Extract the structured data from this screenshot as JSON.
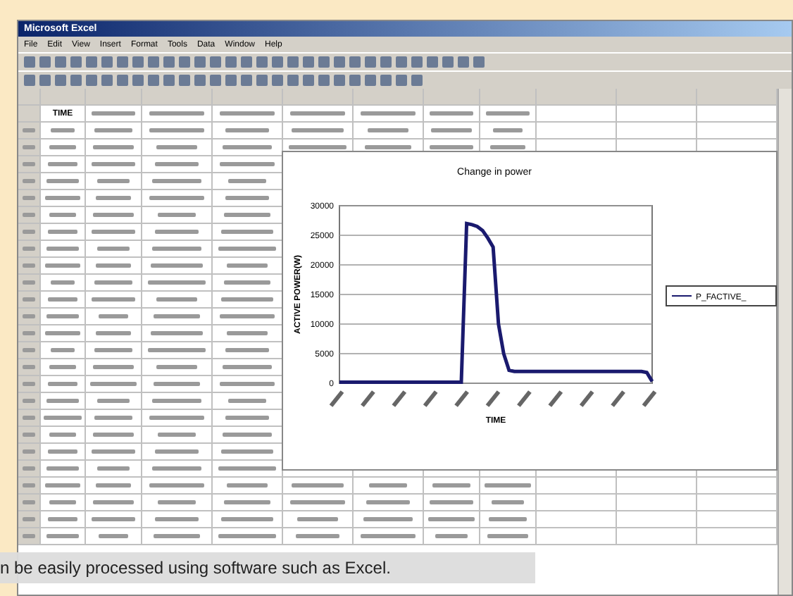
{
  "window": {
    "title": "Microsoft Excel"
  },
  "menu": [
    "File",
    "Edit",
    "View",
    "Insert",
    "Format",
    "Tools",
    "Data",
    "Window",
    "Help"
  ],
  "sheet": {
    "header_cell": "TIME"
  },
  "chart": {
    "chart_data": {
      "type": "line",
      "title": "Change in power",
      "xlabel": "TIME",
      "ylabel": "ACTIVE POWER(W)",
      "grid": true,
      "series": [
        {
          "name": "P_FACTIVE_",
          "color": "#1a1a6e",
          "values": [
            200,
            200,
            200,
            200,
            200,
            200,
            200,
            200,
            200,
            200,
            200,
            200,
            200,
            200,
            200,
            200,
            200,
            200,
            200,
            200,
            200,
            200,
            200,
            200,
            27000,
            26800,
            26500,
            25800,
            24500,
            23000,
            10000,
            5000,
            2200,
            2000,
            2000,
            2000,
            2000,
            2000,
            2000,
            2000,
            2000,
            2000,
            2000,
            2000,
            2000,
            2000,
            2000,
            2000,
            2000,
            2000,
            2000,
            2000,
            2000,
            2000,
            2000,
            2000,
            2000,
            2000,
            1800,
            300
          ]
        }
      ],
      "ylim": [
        0,
        30000
      ],
      "yticks": [
        0,
        5000,
        10000,
        15000,
        20000,
        25000,
        30000
      ]
    }
  },
  "caption": "n be easily processed using software such as Excel."
}
